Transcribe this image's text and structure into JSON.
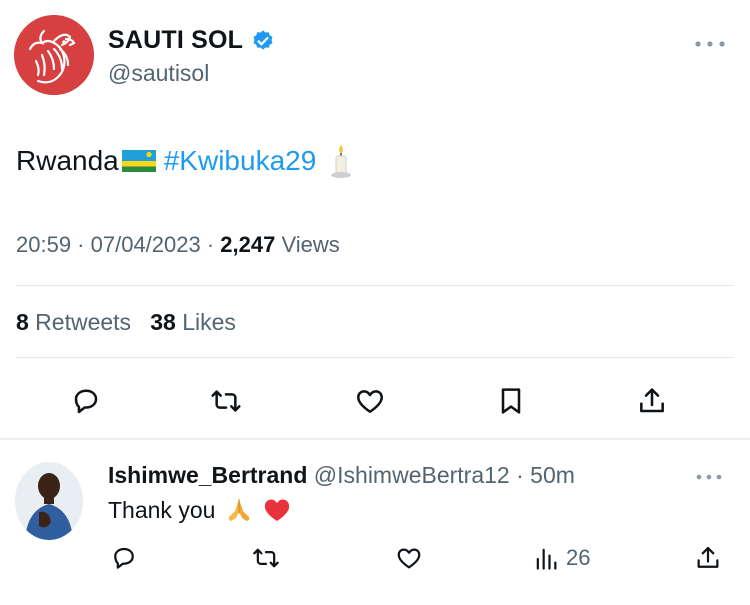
{
  "tweet": {
    "author": {
      "display_name": "SAUTI SOL",
      "handle": "@sautisol",
      "verified": true,
      "avatar_icon": "rooster-logo"
    },
    "text": {
      "word": "Rwanda",
      "flag_icon": "rwanda-flag-emoji",
      "hashtag": "#Kwibuka29",
      "trailing_icon": "candle-emoji"
    },
    "meta": {
      "time": "20:59",
      "sep1": " · ",
      "date": "07/04/2023",
      "sep2": " · ",
      "views_count": "2,247",
      "views_label": " Views"
    },
    "stats": {
      "retweets_count": "8",
      "retweets_label": " Retweets",
      "likes_count": "38",
      "likes_label": " Likes"
    },
    "actions": [
      "reply-icon",
      "retweet-icon",
      "like-icon",
      "bookmark-icon",
      "share-icon"
    ]
  },
  "reply": {
    "display_name": "Ishimwe_Bertrand",
    "handle": "@IshimweBertra12",
    "sep": " · ",
    "time": "50m",
    "text": "Thank you",
    "emojis": [
      "folded-hands-emoji",
      "red-heart-emoji"
    ],
    "views_count": "26",
    "actions": [
      "reply-icon",
      "retweet-icon",
      "like-icon",
      "views-icon",
      "share-icon"
    ]
  },
  "colors": {
    "accent": "#1d9bf0",
    "secondary_text": "#536471",
    "primary_text": "#0f1419",
    "avatar_red": "#d64040"
  }
}
